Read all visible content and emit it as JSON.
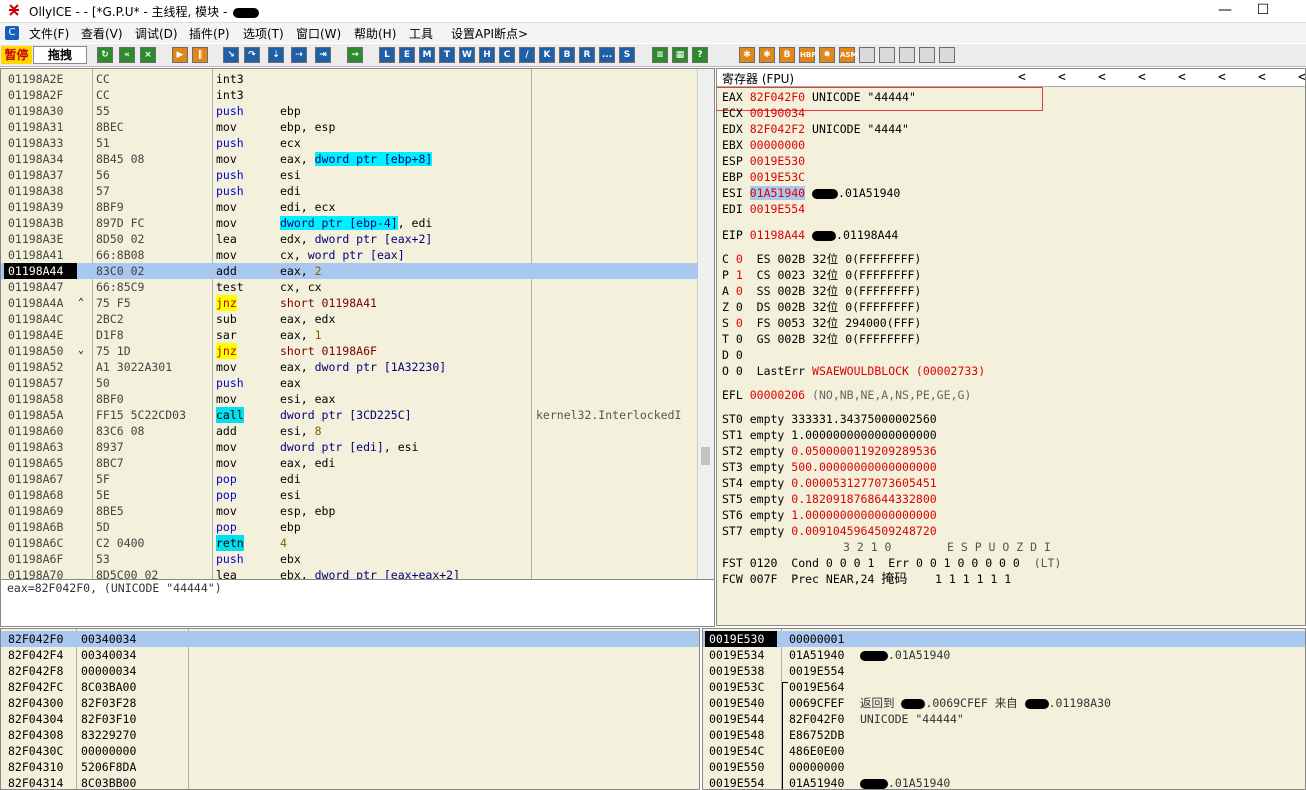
{
  "window": {
    "title": "OllyICE - - [*G.P.U* - 主线程, 模块 - ",
    "minimize": "—",
    "maximize": "☐"
  },
  "menu": [
    "文件(F)",
    "查看(V)",
    "调试(D)",
    "插件(P)",
    "选项(T)",
    "窗口(W)",
    "帮助(H)",
    "工具",
    "设置API断点>"
  ],
  "menu_icon": "C",
  "toolbar": {
    "status": "暂停",
    "search": "拖拽",
    "letters": [
      "L",
      "E",
      "M",
      "T",
      "W",
      "H",
      "C",
      "/",
      "K",
      "B",
      "R",
      "...",
      "S"
    ],
    "extra_labels": [
      "HBP",
      "ASM"
    ]
  },
  "disasm": [
    {
      "addr": "01198A2E",
      "hex": "CC",
      "mn": "int3",
      "ops": []
    },
    {
      "addr": "01198A2F",
      "hex": "CC",
      "mn": "int3",
      "ops": []
    },
    {
      "addr": "01198A30",
      "hex": "55",
      "mn": "push",
      "ops": [
        {
          "t": "ebp"
        }
      ]
    },
    {
      "addr": "01198A31",
      "hex": "8BEC",
      "mn": "mov",
      "ops": [
        {
          "t": "ebp, esp"
        }
      ]
    },
    {
      "addr": "01198A33",
      "hex": "51",
      "mn": "push",
      "ops": [
        {
          "t": "ecx"
        }
      ]
    },
    {
      "addr": "01198A34",
      "hex": "8B45 08",
      "mn": "mov",
      "ops": [
        {
          "t": "eax, "
        },
        {
          "t": "dword ptr [ebp+8]",
          "c": "op-mem"
        }
      ]
    },
    {
      "addr": "01198A37",
      "hex": "56",
      "mn": "push",
      "ops": [
        {
          "t": "esi"
        }
      ]
    },
    {
      "addr": "01198A38",
      "hex": "57",
      "mn": "push",
      "ops": [
        {
          "t": "edi"
        }
      ]
    },
    {
      "addr": "01198A39",
      "hex": "8BF9",
      "mn": "mov",
      "ops": [
        {
          "t": "edi, ecx"
        }
      ]
    },
    {
      "addr": "01198A3B",
      "hex": "897D FC",
      "mn": "mov",
      "ops": [
        {
          "t": "dword ptr [ebp-4]",
          "c": "op-mem"
        },
        {
          "t": ", edi"
        }
      ]
    },
    {
      "addr": "01198A3E",
      "hex": "8D50 02",
      "mn": "lea",
      "ops": [
        {
          "t": "edx, "
        },
        {
          "t": "dword ptr [eax+2]",
          "c": "op-addr"
        }
      ]
    },
    {
      "addr": "01198A41",
      "hex": "66:8B08",
      "mn": "mov",
      "ops": [
        {
          "t": "cx, "
        },
        {
          "t": "word ptr [eax]",
          "c": "op-addr"
        }
      ]
    },
    {
      "addr": "01198A44",
      "hex": "83C0 02",
      "mn": "add",
      "ops": [
        {
          "t": "eax, "
        },
        {
          "t": "2",
          "c": "op-num2"
        }
      ],
      "cur": true
    },
    {
      "addr": "01198A47",
      "hex": "66:85C9",
      "mn": "test",
      "ops": [
        {
          "t": "cx, cx"
        }
      ]
    },
    {
      "addr": "01198A4A",
      "hex": "75 F5",
      "mn": "jnz",
      "ops": [
        {
          "t": "short 01198A41",
          "c": "op-num"
        }
      ],
      "mark": "^"
    },
    {
      "addr": "01198A4C",
      "hex": "2BC2",
      "mn": "sub",
      "ops": [
        {
          "t": "eax, edx"
        }
      ]
    },
    {
      "addr": "01198A4E",
      "hex": "D1F8",
      "mn": "sar",
      "ops": [
        {
          "t": "eax, "
        },
        {
          "t": "1",
          "c": "op-num2"
        }
      ]
    },
    {
      "addr": "01198A50",
      "hex": "75 1D",
      "mn": "jnz",
      "ops": [
        {
          "t": "short 01198A6F",
          "c": "op-num"
        }
      ],
      "mark": "v"
    },
    {
      "addr": "01198A52",
      "hex": "A1 3022A301",
      "mn": "mov",
      "ops": [
        {
          "t": "eax, "
        },
        {
          "t": "dword ptr [1A32230]",
          "c": "op-addr"
        }
      ]
    },
    {
      "addr": "01198A57",
      "hex": "50",
      "mn": "push",
      "ops": [
        {
          "t": "eax"
        }
      ]
    },
    {
      "addr": "01198A58",
      "hex": "8BF0",
      "mn": "mov",
      "ops": [
        {
          "t": "esi, eax"
        }
      ]
    },
    {
      "addr": "01198A5A",
      "hex": "FF15 5C22CD03",
      "mn": "call",
      "ops": [
        {
          "t": "dword ptr [3CD225C]",
          "c": "op-addr"
        }
      ],
      "comment": "kernel32.InterlockedI"
    },
    {
      "addr": "01198A60",
      "hex": "83C6 08",
      "mn": "add",
      "ops": [
        {
          "t": "esi, "
        },
        {
          "t": "8",
          "c": "op-num2"
        }
      ]
    },
    {
      "addr": "01198A63",
      "hex": "8937",
      "mn": "mov",
      "ops": [
        {
          "t": "dword ptr [edi]",
          "c": "op-addr"
        },
        {
          "t": ", esi"
        }
      ]
    },
    {
      "addr": "01198A65",
      "hex": "8BC7",
      "mn": "mov",
      "ops": [
        {
          "t": "eax, edi"
        }
      ]
    },
    {
      "addr": "01198A67",
      "hex": "5F",
      "mn": "pop",
      "ops": [
        {
          "t": "edi"
        }
      ]
    },
    {
      "addr": "01198A68",
      "hex": "5E",
      "mn": "pop",
      "ops": [
        {
          "t": "esi"
        }
      ]
    },
    {
      "addr": "01198A69",
      "hex": "8BE5",
      "mn": "mov",
      "ops": [
        {
          "t": "esp, ebp"
        }
      ]
    },
    {
      "addr": "01198A6B",
      "hex": "5D",
      "mn": "pop",
      "ops": [
        {
          "t": "ebp"
        }
      ]
    },
    {
      "addr": "01198A6C",
      "hex": "C2 0400",
      "mn": "retn",
      "ops": [
        {
          "t": "4",
          "c": "op-num2"
        }
      ]
    },
    {
      "addr": "01198A6F",
      "hex": "53",
      "mn": "push",
      "ops": [
        {
          "t": "ebx"
        }
      ]
    },
    {
      "addr": "01198A70",
      "hex": "8D5C00 02",
      "mn": "lea",
      "ops": [
        {
          "t": "ebx, "
        },
        {
          "t": "dword ptr [eax+eax+2]",
          "c": "op-addr"
        }
      ]
    }
  ],
  "info_text": "eax=82F042F0, (UNICODE \"44444\")",
  "registers": {
    "header": "寄存器 (FPU)",
    "gpr": [
      {
        "name": "EAX",
        "val": "82F042F0",
        "note": "UNICODE \"44444\""
      },
      {
        "name": "ECX",
        "val": "00190034",
        "note": ""
      },
      {
        "name": "EDX",
        "val": "82F042F2",
        "note": "UNICODE \"4444\""
      },
      {
        "name": "EBX",
        "val": "00000000",
        "note": ""
      },
      {
        "name": "ESP",
        "val": "0019E530",
        "note": ""
      },
      {
        "name": "EBP",
        "val": "0019E53C",
        "note": ""
      },
      {
        "name": "ESI",
        "val": "01A51940",
        "note": ".01A51940"
      },
      {
        "name": "EDI",
        "val": "0019E554",
        "note": ""
      }
    ],
    "eip": {
      "name": "EIP",
      "val": "01198A44",
      "note": ".01198A44"
    },
    "flags": [
      {
        "f": "C",
        "v": "0",
        "red": true,
        "seg": "ES",
        "sv": "002B",
        "bits": "32位",
        "base": "0(FFFFFFFF)"
      },
      {
        "f": "P",
        "v": "1",
        "red": true,
        "seg": "CS",
        "sv": "0023",
        "bits": "32位",
        "base": "0(FFFFFFFF)"
      },
      {
        "f": "A",
        "v": "0",
        "red": true,
        "seg": "SS",
        "sv": "002B",
        "bits": "32位",
        "base": "0(FFFFFFFF)"
      },
      {
        "f": "Z",
        "v": "0",
        "red": false,
        "seg": "DS",
        "sv": "002B",
        "bits": "32位",
        "base": "0(FFFFFFFF)"
      },
      {
        "f": "S",
        "v": "0",
        "red": true,
        "seg": "FS",
        "sv": "0053",
        "bits": "32位",
        "base": "294000(FFF)"
      },
      {
        "f": "T",
        "v": "0",
        "red": false,
        "seg": "GS",
        "sv": "002B",
        "bits": "32位",
        "base": "0(FFFFFFFF)"
      },
      {
        "f": "D",
        "v": "0",
        "red": false,
        "seg": "",
        "sv": "",
        "bits": "",
        "base": ""
      }
    ],
    "lasterr": {
      "o": "O 0",
      "label": "LastErr",
      "val": "WSAEWOULDBLOCK (00002733)"
    },
    "efl": {
      "label": "EFL",
      "val": "00000206",
      "note": "(NO,NB,NE,A,NS,PE,GE,G)"
    },
    "fpu": [
      {
        "name": "ST0",
        "tag": "empty",
        "val": "333331.34375000002560",
        "red": false
      },
      {
        "name": "ST1",
        "tag": "empty",
        "val": "1.0000000000000000000",
        "red": false
      },
      {
        "name": "ST2",
        "tag": "empty",
        "val": "0.0500000119209289536",
        "red": true
      },
      {
        "name": "ST3",
        "tag": "empty",
        "val": "500.00000000000000000",
        "red": true
      },
      {
        "name": "ST4",
        "tag": "empty",
        "val": "0.0000531277073605451",
        "red": true
      },
      {
        "name": "ST5",
        "tag": "empty",
        "val": "0.1820918768644332800",
        "red": true
      },
      {
        "name": "ST6",
        "tag": "empty",
        "val": "1.0000000000000000000",
        "red": true
      },
      {
        "name": "ST7",
        "tag": "empty",
        "val": "0.0091045964509248720",
        "red": true
      }
    ],
    "fpu_hdr1": "3 2 1 0",
    "fpu_hdr2": "E S P U O Z D I",
    "fst": {
      "label": "FST",
      "val": "0120",
      "cond_label": "Cond",
      "cond": "0 0 0 1",
      "err_label": "Err",
      "err": "0 0 1 0 0 0 0 0",
      "lt": "(LT)"
    },
    "fcw": {
      "label": "FCW",
      "val": "007F",
      "prec_label": "Prec",
      "prec": "NEAR,24",
      "mask_label": "掩码",
      "mask": "1 1 1 1 1 1"
    }
  },
  "dump": [
    {
      "a": "82F042F0",
      "v": "00340034",
      "sel": true
    },
    {
      "a": "82F042F4",
      "v": "00340034"
    },
    {
      "a": "82F042F8",
      "v": "00000034"
    },
    {
      "a": "82F042FC",
      "v": "8C03BA00"
    },
    {
      "a": "82F04300",
      "v": "82F03F28"
    },
    {
      "a": "82F04304",
      "v": "82F03F10"
    },
    {
      "a": "82F04308",
      "v": "83229270"
    },
    {
      "a": "82F0430C",
      "v": "00000000"
    },
    {
      "a": "82F04310",
      "v": "5206F8DA"
    },
    {
      "a": "82F04314",
      "v": "8C03BB00"
    }
  ],
  "stack": [
    {
      "a": "0019E530",
      "v": "00000001",
      "c": "",
      "sel": true
    },
    {
      "a": "0019E534",
      "v": "01A51940",
      "c": ".01A51940",
      "redact": true
    },
    {
      "a": "0019E538",
      "v": "0019E554",
      "c": ""
    },
    {
      "a": "0019E53C",
      "v": "0019E564",
      "c": ""
    },
    {
      "a": "0019E540",
      "v": "0069CFEF",
      "c_pre": "返回到",
      "c1": ".0069CFEF",
      "c_mid": "来自",
      "c2": ".01198A30"
    },
    {
      "a": "0019E544",
      "v": "82F042F0",
      "c": "UNICODE \"44444\""
    },
    {
      "a": "0019E548",
      "v": "E86752DB",
      "c": ""
    },
    {
      "a": "0019E54C",
      "v": "486E0E00",
      "c": ""
    },
    {
      "a": "0019E550",
      "v": "00000000",
      "c": ""
    },
    {
      "a": "0019E554",
      "v": "01A51940",
      "c": ".01A51940",
      "redact": true
    }
  ]
}
